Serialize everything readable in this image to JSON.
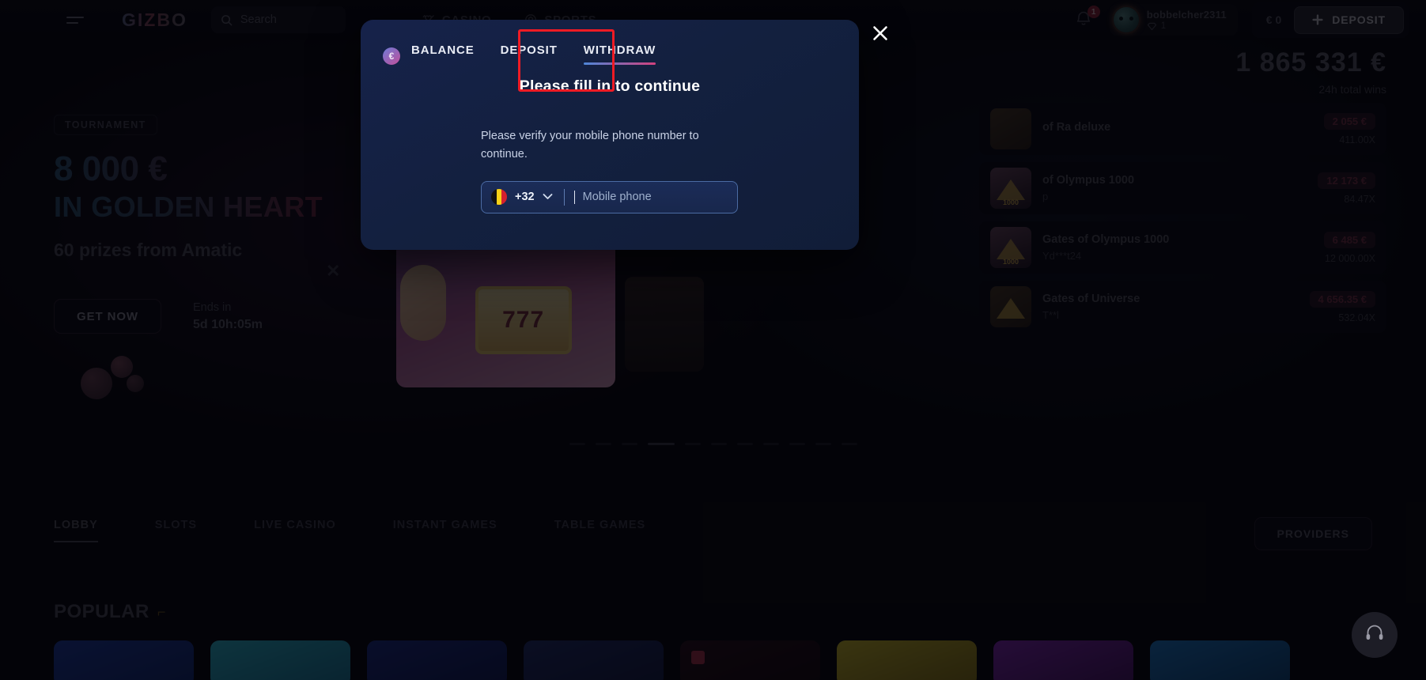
{
  "header": {
    "logo": "GIZBO",
    "menu_icon": "hamburger-icon",
    "search": {
      "label": "Search",
      "icon": "search-icon"
    },
    "nav": [
      {
        "label": "CASINO",
        "icon": "casino-icon"
      },
      {
        "label": "SPORTS",
        "icon": "sports-ball-icon"
      }
    ],
    "notifications": {
      "icon": "bell-icon",
      "count": "1"
    },
    "user": {
      "name": "bobbelcher2311",
      "gems": "1",
      "gem_icon": "diamond-icon",
      "avatar": "user-avatar"
    },
    "wallet": {
      "balance": "€ 0"
    },
    "deposit_button": {
      "label": "DEPOSIT",
      "icon": "plus-icon"
    }
  },
  "hero": {
    "badge": "TOURNAMENT",
    "amount": "8 000 €",
    "title": "IN GOLDEN HEART",
    "subtitle": "60 prizes from Amatic",
    "cta": "GET NOW",
    "ends_label": "Ends in",
    "ends_value": "5d 10h:05m",
    "slot_symbol": "777",
    "close_icon": "banner-close-icon"
  },
  "winners": {
    "total_amount": "1 865 331 €",
    "total_label": "24h total wins",
    "rows": [
      {
        "game": "of Ra deluxe",
        "user": "",
        "amount": "2 055 €",
        "multiplier": "411.00X"
      },
      {
        "game": "of Olympus 1000",
        "user": "p",
        "amount": "12 173 €",
        "multiplier": "84.47X"
      },
      {
        "game": "Gates of Olympus 1000",
        "user": "Yd***t24",
        "amount": "6 485 €",
        "multiplier": "12 000.00X"
      },
      {
        "game": "Gates of Universe",
        "user": "T**l",
        "amount": "4 656.35 €",
        "multiplier": "532.04X"
      }
    ]
  },
  "category_tabs": [
    {
      "label": "LOBBY",
      "active": true
    },
    {
      "label": "SLOTS",
      "active": false
    },
    {
      "label": "LIVE CASINO",
      "active": false
    },
    {
      "label": "INSTANT GAMES",
      "active": false
    },
    {
      "label": "TABLE GAMES",
      "active": false
    }
  ],
  "providers_button": "PROVIDERS",
  "popular": {
    "title": "POPULAR",
    "icon": "fire-icon"
  },
  "support": {
    "icon": "headset-icon"
  },
  "modal": {
    "tabs": [
      {
        "label": "BALANCE",
        "active": false
      },
      {
        "label": "DEPOSIT",
        "active": false
      },
      {
        "label": "WITHDRAW",
        "active": true
      }
    ],
    "coin_icon": "euro-coin-icon",
    "heading": "Please fill in to continue",
    "description": "Please verify your mobile phone number to continue.",
    "phone": {
      "country_flag": "belgium-flag-icon",
      "dial_code": "+32",
      "chevron": "chevron-down-icon",
      "placeholder": "Mobile phone",
      "value": ""
    },
    "close_icon": "close-icon",
    "highlight_color": "#ef1b24"
  }
}
